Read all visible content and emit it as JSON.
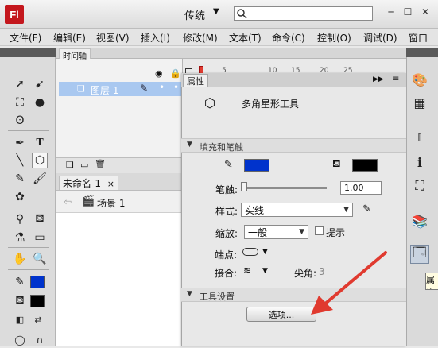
{
  "app": {
    "logo_text": "Fl",
    "workspace": "传统",
    "search_placeholder": ""
  },
  "menu": [
    "文件(F)",
    "编辑(E)",
    "视图(V)",
    "插入(I)",
    "修改(M)",
    "文本(T)",
    "命令(C)",
    "控制(O)",
    "调试(D)",
    "窗口"
  ],
  "timeline": {
    "tab": "时间轴",
    "frame_numbers": [
      "5",
      "10",
      "15",
      "20",
      "25"
    ],
    "layer": "图层 1"
  },
  "document": {
    "tab": "未命名-1",
    "tab_close": "×",
    "scene": "场景 1"
  },
  "properties": {
    "tab": "属性",
    "tool_name": "多角星形工具",
    "fill_stroke_section": "填充和笔触",
    "stroke_color": "#0033cc",
    "fill_color": "#000000",
    "stroke_label": "笔触:",
    "stroke_value": "1.00",
    "style_label": "样式:",
    "style_value": "实线",
    "scale_label": "缩放:",
    "scale_value": "一般",
    "hint_label": "提示",
    "cap_label": "端点:",
    "join_label": "接合:",
    "miter_label": "尖角:",
    "miter_value": "3",
    "tool_settings_section": "工具设置",
    "options_button": "选项..."
  },
  "dock": {
    "tooltip": "属性"
  },
  "colors": {
    "accent": "#e03a2f",
    "layer_highlight": "#a9c8f0",
    "toolbar_stroke": "#0033cc",
    "toolbar_fill": "#000000"
  }
}
